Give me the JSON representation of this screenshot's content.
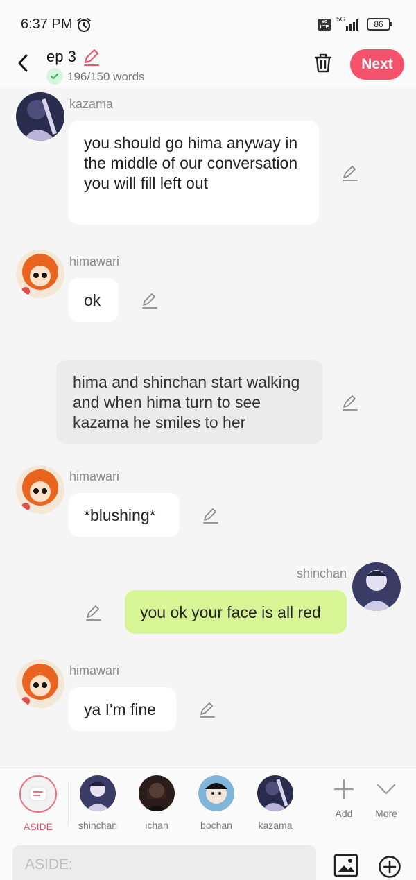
{
  "status": {
    "time": "6:37 PM",
    "network": "5G",
    "volte": "Vo LTE",
    "battery": "86"
  },
  "header": {
    "title": "ep 3",
    "word_count": "196/150 words",
    "next_label": "Next"
  },
  "messages": [
    {
      "speaker": "kazama",
      "text": "you should go hima anyway in the middle of our conversation you will fill left out"
    },
    {
      "speaker": "himawari",
      "text": "ok"
    },
    {
      "type": "aside",
      "text": "hima and shinchan start walking and when hima turn to see kazama he smiles to her"
    },
    {
      "speaker": "himawari",
      "text": "*blushing*"
    },
    {
      "speaker": "shinchan",
      "text": "you ok your face is all red"
    },
    {
      "speaker": "himawari",
      "text": "ya I'm fine"
    }
  ],
  "characters": [
    {
      "label": "ASIDE"
    },
    {
      "label": "shinchan"
    },
    {
      "label": "ichan"
    },
    {
      "label": "bochan"
    },
    {
      "label": "kazama"
    }
  ],
  "tools": {
    "add_label": "Add",
    "more_label": "More"
  },
  "input": {
    "placeholder": "ASIDE:"
  },
  "colors": {
    "accent": "#f4516b",
    "bubble_main": "#d8f595",
    "aside_bubble": "#ebebeb"
  }
}
